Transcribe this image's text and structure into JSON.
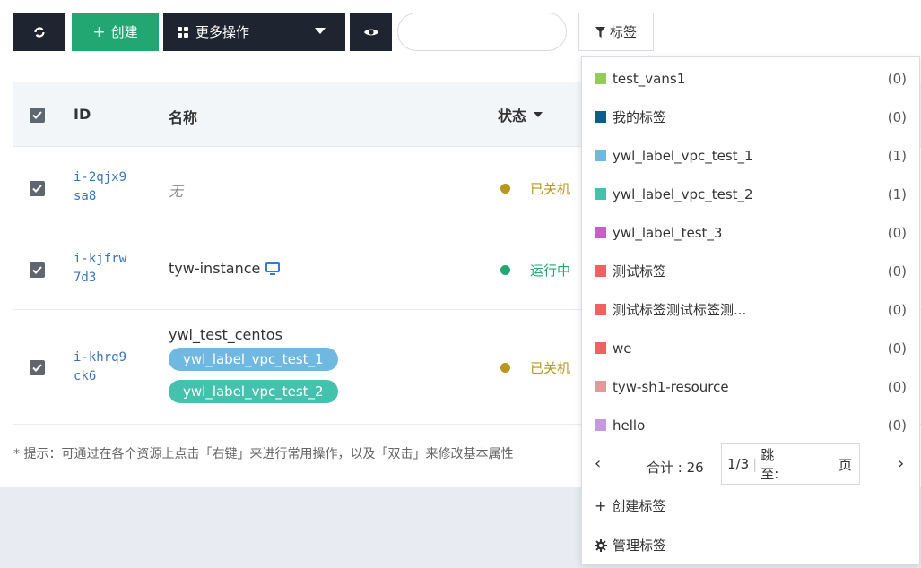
{
  "toolbar": {
    "create_label": "创建",
    "more_label": "更多操作",
    "tag_label": "标签",
    "search_placeholder": ""
  },
  "table": {
    "headers": {
      "id": "ID",
      "name": "名称",
      "status": "状态"
    },
    "rows": [
      {
        "id": "i-2qjx9sa8",
        "id_line1": "i-2qjx9",
        "id_line2": "sa8",
        "name": "无",
        "status": "已关机",
        "status_color": "#b8961f",
        "tags": []
      },
      {
        "id": "i-kjfrw7d3",
        "id_line1": "i-kjfrw",
        "id_line2": "7d3",
        "name": "tyw-instance",
        "status": "运行中",
        "status_color": "#22a672",
        "tags": []
      },
      {
        "id": "i-khrq9ck6",
        "id_line1": "i-khrq9",
        "id_line2": "ck6",
        "name": "ywl_test_centos",
        "status": "已关机",
        "status_color": "#b8961f",
        "tags": [
          {
            "label": "ywl_label_vpc_test_1",
            "color": "#6fb8e2"
          },
          {
            "label": "ywl_label_vpc_test_2",
            "color": "#44c2ae"
          }
        ]
      }
    ]
  },
  "hint": "* 提示：可通过在各个资源上点击「右键」来进行常用操作，以及「双击」来修改基本属性",
  "tag_dropdown": {
    "items": [
      {
        "label": "test_vans1",
        "count": "(0)",
        "color": "#94cc5a"
      },
      {
        "label": "我的标签",
        "count": "(0)",
        "color": "#0a5f8a"
      },
      {
        "label": "ywl_label_vpc_test_1",
        "count": "(1)",
        "color": "#6fb8e2"
      },
      {
        "label": "ywl_label_vpc_test_2",
        "count": "(1)",
        "color": "#44c2ae"
      },
      {
        "label": "ywl_label_test_3",
        "count": "(0)",
        "color": "#c95ec9"
      },
      {
        "label": "测试标签",
        "count": "(0)",
        "color": "#f06262"
      },
      {
        "label": "测试标签测试标签测...",
        "count": "(0)",
        "color": "#f06262"
      },
      {
        "label": "we",
        "count": "(0)",
        "color": "#f06262"
      },
      {
        "label": "tyw-sh1-resource",
        "count": "(0)",
        "color": "#e09a9a"
      },
      {
        "label": "hello",
        "count": "(0)",
        "color": "#c39ae0"
      }
    ],
    "pager": {
      "total": "合计 : 26",
      "page": "1/3",
      "jump_label": "跳至:",
      "unit": "页"
    },
    "create_label": "创建标签",
    "manage_label": "管理标签"
  },
  "colors": {
    "dark": "#1f2530",
    "green": "#22a672",
    "link": "#3a74b8"
  }
}
